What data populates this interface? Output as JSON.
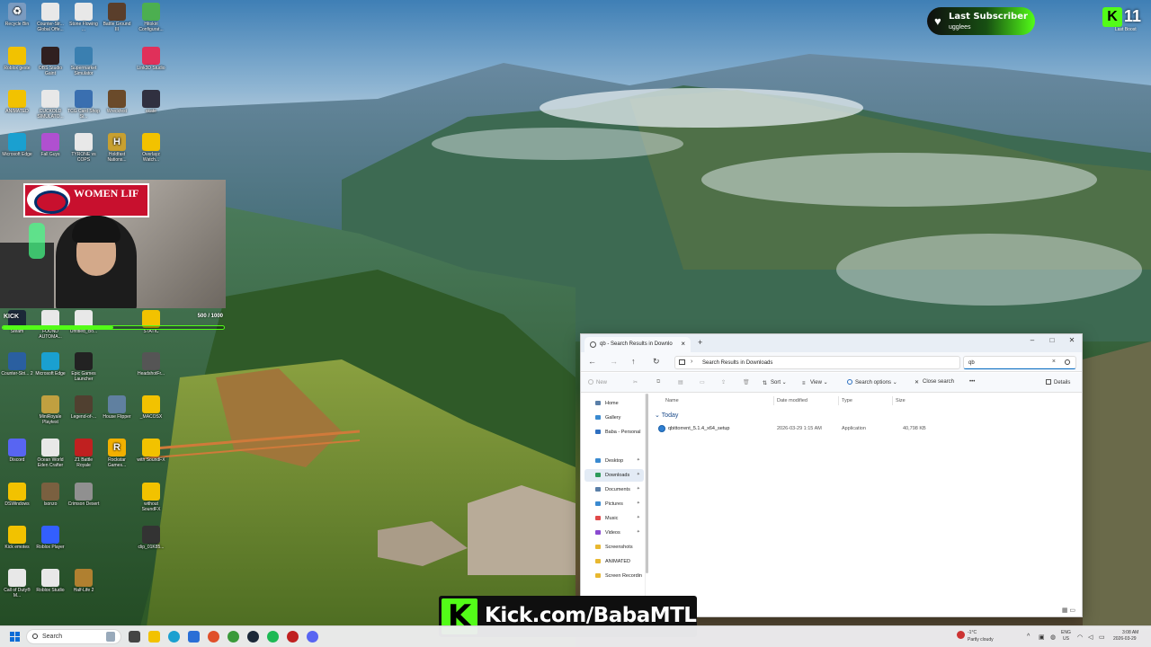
{
  "desktop": {
    "icons": [
      {
        "label": "Recycle Bin",
        "color": "#7a9bc0",
        "glyph": "♻"
      },
      {
        "label": "Counter-Str... Global Offe...",
        "color": "#e8e8e8",
        "glyph": ""
      },
      {
        "label": "Stone Flowing ...",
        "color": "#e8e8e8",
        "glyph": ""
      },
      {
        "label": "Battle Ground III",
        "color": "#5a3e2b",
        "glyph": ""
      },
      {
        "label": "Hitokiri Configurat...",
        "color": "#4caf50",
        "glyph": ""
      },
      {
        "label": "Roblox geste",
        "color": "#f2c200",
        "glyph": ""
      },
      {
        "label": "OBS Studio Gaint",
        "color": "#302020",
        "glyph": ""
      },
      {
        "label": "Supermarket Simulator",
        "color": "#3a7fb0",
        "glyph": ""
      },
      {
        "label": "Link3D Studio",
        "color": "#e0305a",
        "glyph": ""
      },
      {
        "label": "ANIMATED",
        "color": "#f2c200",
        "glyph": ""
      },
      {
        "label": "CUCKOLD SIMULATO...",
        "color": "#e8e8e8",
        "glyph": ""
      },
      {
        "label": "TCG Card Shop Si...",
        "color": "#3a6fb0",
        "glyph": ""
      },
      {
        "label": "Wreckfest",
        "color": "#6a4a2a",
        "glyph": ""
      },
      {
        "label": "skate",
        "color": "#303040",
        "glyph": ""
      },
      {
        "label": "Microsoft Edge",
        "color": "#1aa0d0",
        "glyph": ""
      },
      {
        "label": "Fall Guys",
        "color": "#b050d0",
        "glyph": ""
      },
      {
        "label": "TYRONE vs COPS",
        "color": "#e8e8e8",
        "glyph": ""
      },
      {
        "label": "Holdfast Nations...",
        "color": "#c8a030",
        "glyph": "H"
      },
      {
        "label": "Overlayz Watch...",
        "color": "#f2c200",
        "glyph": ""
      },
      {
        "label": "Steam",
        "color": "#1b2838",
        "glyph": ""
      },
      {
        "label": "FOUND AUTOMA...",
        "color": "#e8e8e8",
        "glyph": ""
      },
      {
        "label": "Untitled_clo...",
        "color": "#e8e8e8",
        "glyph": ""
      },
      {
        "label": "STATIC",
        "color": "#f2c200",
        "glyph": ""
      },
      {
        "label": "Counter-Stri... 2",
        "color": "#2a5fa0",
        "glyph": ""
      },
      {
        "label": "Microsoft Edge",
        "color": "#1aa0d0",
        "glyph": ""
      },
      {
        "label": "Epic Games Launcher",
        "color": "#222222",
        "glyph": ""
      },
      {
        "label": "HeadshotFr...",
        "color": "#555555",
        "glyph": ""
      },
      {
        "label": "MiniRoyale Playtest",
        "color": "#c0a040",
        "glyph": ""
      },
      {
        "label": "Legend-of-...",
        "color": "#504030",
        "glyph": ""
      },
      {
        "label": "House Flipper",
        "color": "#6080a0",
        "glyph": ""
      },
      {
        "label": "_MACOSX",
        "color": "#f2c200",
        "glyph": ""
      },
      {
        "label": "Discord",
        "color": "#5865f2",
        "glyph": ""
      },
      {
        "label": "Ocean World Eden Crafter",
        "color": "#e8e8e8",
        "glyph": ""
      },
      {
        "label": "Z1 Battle Royale",
        "color": "#c02020",
        "glyph": ""
      },
      {
        "label": "Rockstar Games...",
        "color": "#f2b000",
        "glyph": "R"
      },
      {
        "label": "with SoundFX",
        "color": "#f2c200",
        "glyph": ""
      },
      {
        "label": "DSWindows",
        "color": "#f2c200",
        "glyph": ""
      },
      {
        "label": "Isonzo",
        "color": "#7a6040",
        "glyph": ""
      },
      {
        "label": "Crimson Desert",
        "color": "#909090",
        "glyph": ""
      },
      {
        "label": "without SoundFX",
        "color": "#f2c200",
        "glyph": ""
      },
      {
        "label": "Kick emotes",
        "color": "#f2c200",
        "glyph": ""
      },
      {
        "label": "Roblox Player",
        "color": "#335fff",
        "glyph": ""
      },
      {
        "label": "clip_01K85...",
        "color": "#333333",
        "glyph": ""
      },
      {
        "label": "Call of Duty® M...",
        "color": "#e8e8e8",
        "glyph": ""
      },
      {
        "label": "Roblox Studio",
        "color": "#e8e8e8",
        "glyph": ""
      },
      {
        "label": "Half-Life 2",
        "color": "#b08030",
        "glyph": ""
      }
    ]
  },
  "webcam": {
    "banner_text": "WOMEN LIF",
    "goal": {
      "platform": "KICK",
      "current": 500,
      "target": 1000,
      "label": "500 / 1000"
    }
  },
  "last_subscriber": {
    "title": "Last Subscriber",
    "name": "ugglees"
  },
  "kick_counter": {
    "value": "11",
    "caption": "Last Boost"
  },
  "explorer": {
    "tab": {
      "label": "qb - Search Results in Downlo"
    },
    "address": "Search Results in Downloads",
    "search_value": "qb",
    "commands": {
      "new": "New",
      "sort": "Sort",
      "view": "View",
      "search_options": "Search options",
      "close_search": "Close search",
      "more": "•••",
      "details": "Details"
    },
    "nav": [
      {
        "label": "Home",
        "color": "#5a7fa8",
        "pinned": false,
        "selected": false
      },
      {
        "label": "Gallery",
        "color": "#3a8ad0",
        "pinned": false,
        "selected": false
      },
      {
        "label": "Baba - Personal",
        "color": "#2f6fc0",
        "pinned": false,
        "selected": false
      },
      {
        "label": "Desktop",
        "color": "#3a8ad0",
        "pinned": true,
        "selected": false
      },
      {
        "label": "Downloads",
        "color": "#2f9a5a",
        "pinned": true,
        "selected": true
      },
      {
        "label": "Documents",
        "color": "#5a7fa8",
        "pinned": true,
        "selected": false
      },
      {
        "label": "Pictures",
        "color": "#3a8ad0",
        "pinned": true,
        "selected": false
      },
      {
        "label": "Music",
        "color": "#e04a4a",
        "pinned": true,
        "selected": false
      },
      {
        "label": "Videos",
        "color": "#8a4ad0",
        "pinned": true,
        "selected": false
      },
      {
        "label": "Screenshots",
        "color": "#e8b830",
        "pinned": false,
        "selected": false
      },
      {
        "label": "ANIMATED",
        "color": "#e8b830",
        "pinned": false,
        "selected": false
      },
      {
        "label": "Screen Recordin",
        "color": "#e8b830",
        "pinned": false,
        "selected": false
      }
    ],
    "columns": [
      "Name",
      "Date modified",
      "Type",
      "Size"
    ],
    "group": "Today",
    "files": [
      {
        "name": "qbittorrent_5.1.4_x64_setup",
        "date": "2026-03-29 1:15 AM",
        "type": "Application",
        "size": "40,798 KB"
      }
    ]
  },
  "kick_banner": {
    "text": "Kick.com/BabaMTL"
  },
  "taskbar": {
    "search_placeholder": "Search",
    "weather": {
      "temp": "-1°C",
      "condition": "Partly cloudy"
    },
    "lang": "ENG",
    "region": "US",
    "time": "3:08 AM",
    "date": "2026-03-29"
  }
}
